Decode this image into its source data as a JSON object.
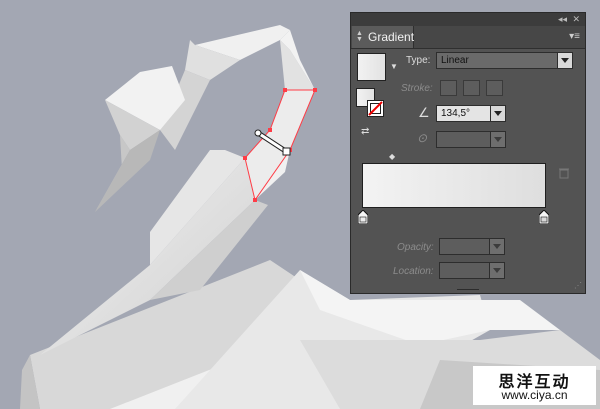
{
  "panel": {
    "tab_title": "Gradient",
    "title_icons": [
      "collapse-icon",
      "close-icon"
    ],
    "type_label": "Type:",
    "type_value": "Linear",
    "stroke_label": "Stroke:",
    "angle_value": "134,5°",
    "opacity_label": "Opacity:",
    "location_label": "Location:"
  },
  "watermark": {
    "text": "思洋互动",
    "url": "www.ciya.cn"
  },
  "colors": {
    "background": "#a3a7b3",
    "panel": "#535353",
    "selection": "#ff3c46"
  }
}
